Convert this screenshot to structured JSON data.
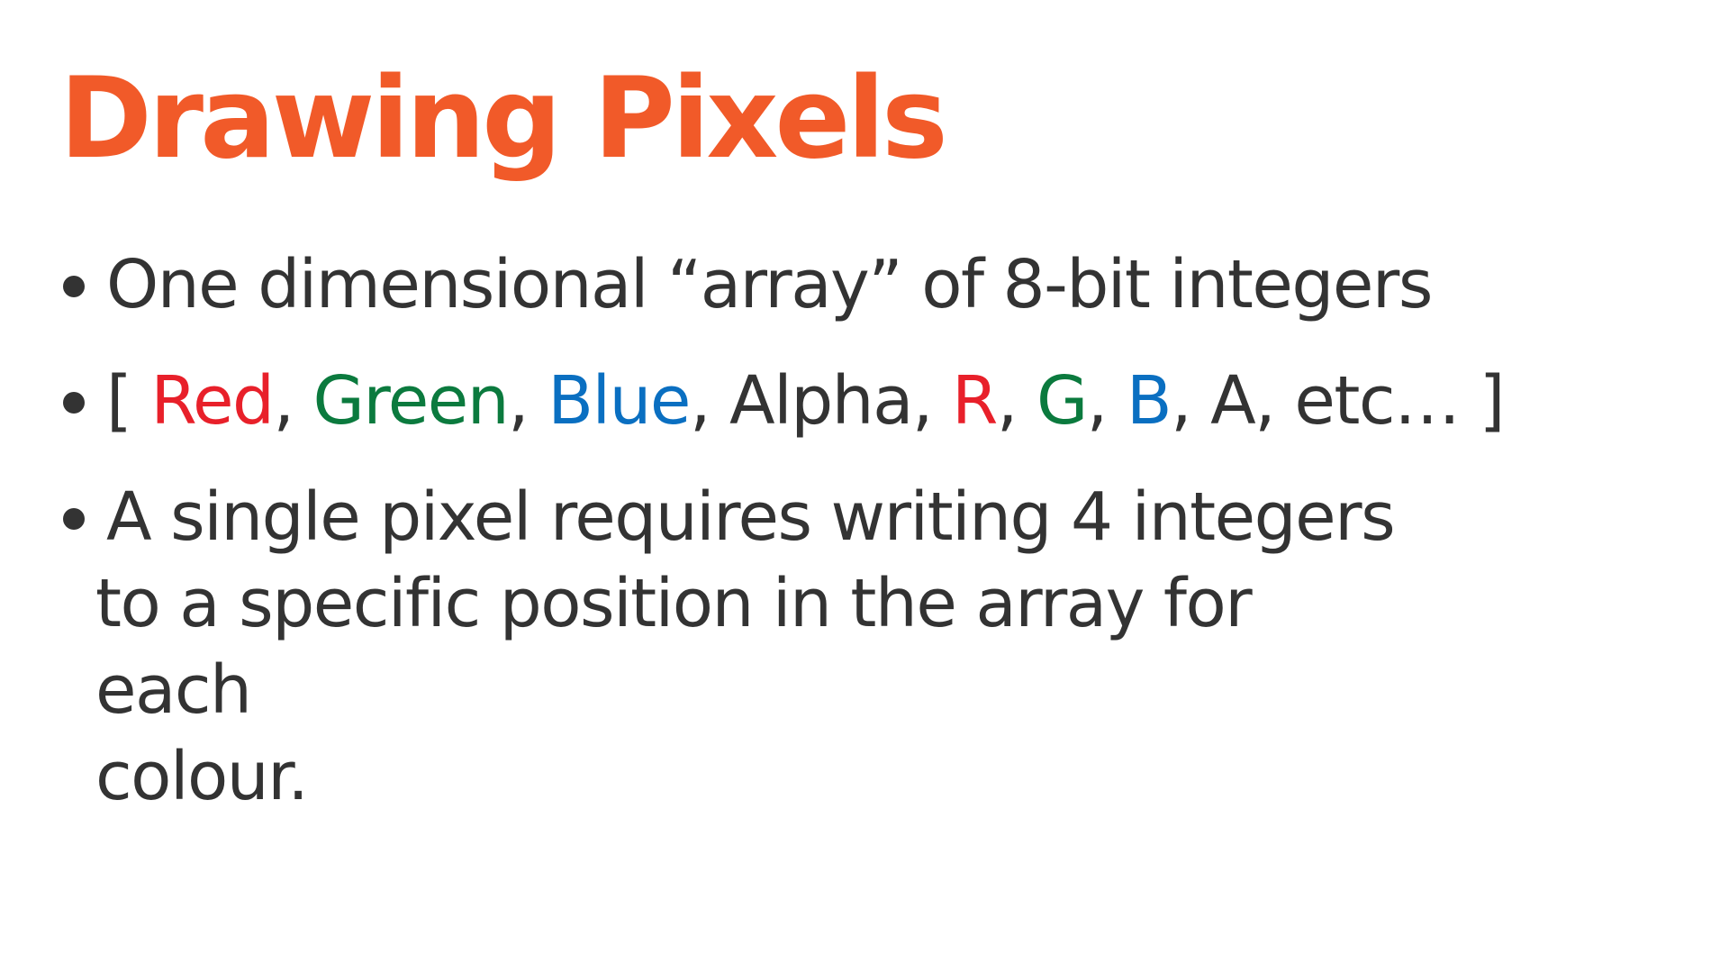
{
  "slide": {
    "title": "Drawing Pixels",
    "bullets": [
      {
        "text": "One dimensional “array” of 8-bit integers"
      },
      {
        "segments": [
          {
            "text": "[ ",
            "color": "#333333"
          },
          {
            "text": "Red",
            "color": "#e8202a"
          },
          {
            "text": ", ",
            "color": "#333333"
          },
          {
            "text": "Green",
            "color": "#0b7a3e"
          },
          {
            "text": ", ",
            "color": "#333333"
          },
          {
            "text": "Blue",
            "color": "#0a6fc1"
          },
          {
            "text": ", Alpha, ",
            "color": "#333333"
          },
          {
            "text": "R",
            "color": "#e8202a"
          },
          {
            "text": ", ",
            "color": "#333333"
          },
          {
            "text": "G",
            "color": "#0b7a3e"
          },
          {
            "text": ", ",
            "color": "#333333"
          },
          {
            "text": "B",
            "color": "#0a6fc1"
          },
          {
            "text": ", A, etc… ]",
            "color": "#333333"
          }
        ]
      },
      {
        "lines": [
          "A single pixel requires writing 4 integers",
          "to a specific position in the array for each",
          "colour."
        ]
      }
    ]
  },
  "colors": {
    "title": "#f15a29",
    "text": "#333333",
    "red": "#e8202a",
    "green": "#0b7a3e",
    "blue": "#0a6fc1",
    "background": "#ffffff"
  }
}
